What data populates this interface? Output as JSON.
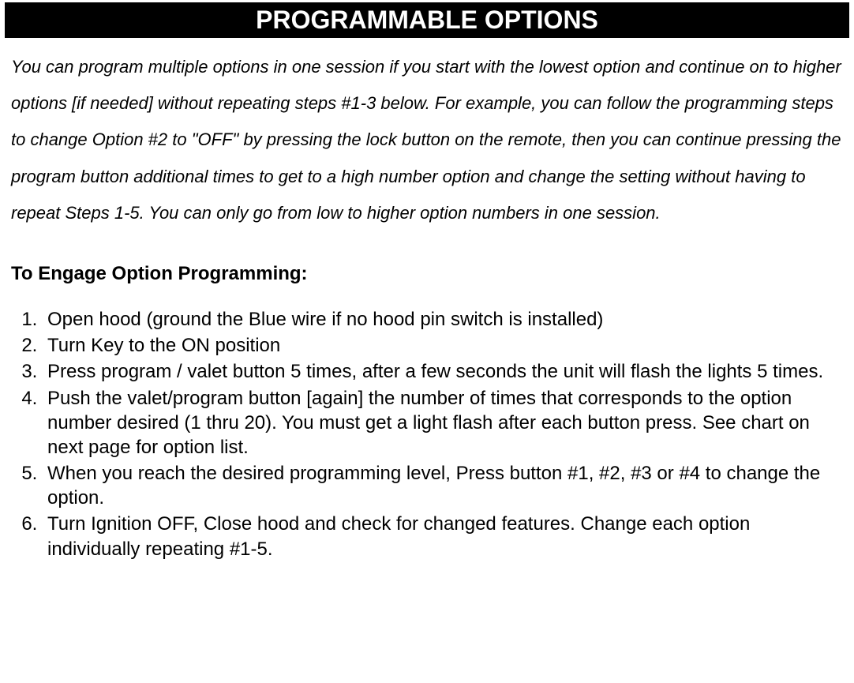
{
  "title": "PROGRAMMABLE OPTIONS",
  "intro": "You can program multiple options in one session if you start with the lowest option and continue on to higher options [if needed] without repeating steps #1-3 below.  For example, you can follow the programming steps to change Option #2 to \"OFF\" by pressing the lock button on the remote, then you can continue pressing the program button additional times to get to a high number option and change the setting without having to repeat Steps 1-5.  You can only go from low to higher option numbers in one session.",
  "subheading": "To Engage Option Programming:",
  "steps": [
    "Open hood (ground the Blue wire if no hood pin switch is installed)",
    "Turn Key to the ON position",
    "Press program / valet button 5 times, after a few seconds the unit will flash the lights 5 times.",
    "Push the valet/program button [again] the number of times that corresponds to the option number desired (1 thru 20).  You must get a light flash after each button press.  See chart on next page for option list.",
    "When you reach the desired programming level, Press button #1, #2, #3 or #4 to change the option.",
    "Turn Ignition OFF, Close hood and check for changed features. Change each option individually repeating #1-5."
  ]
}
